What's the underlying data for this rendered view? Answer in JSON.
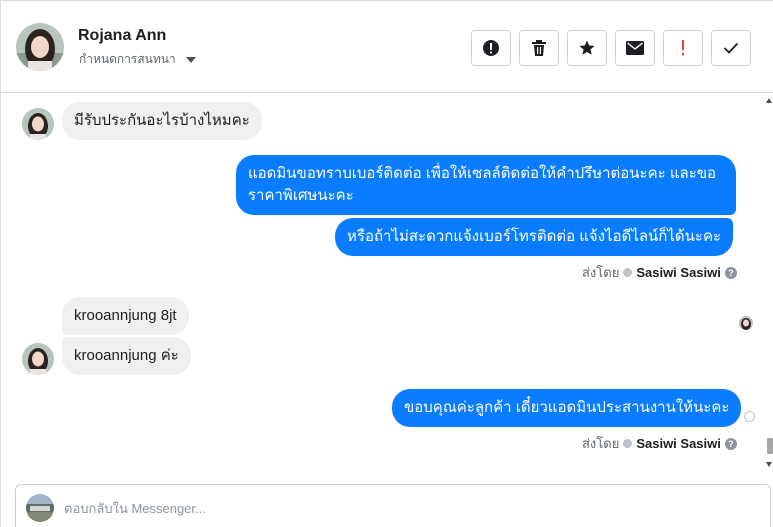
{
  "header": {
    "contact_name": "Rojana Ann",
    "assign_label": "กำหนดการสนทนา",
    "actions": [
      {
        "name": "mark-spam",
        "icon": "exclamation-circle-icon"
      },
      {
        "name": "delete",
        "icon": "trash-icon"
      },
      {
        "name": "star",
        "icon": "star-icon"
      },
      {
        "name": "mark-unread",
        "icon": "envelope-icon"
      },
      {
        "name": "follow-up",
        "icon": "exclamation-icon",
        "color": "#fa3e3e"
      },
      {
        "name": "mark-done",
        "icon": "check-icon"
      }
    ]
  },
  "messages": [
    {
      "direction": "in",
      "text": "มีรับประกันอะไรบ้างไหมคะ"
    },
    {
      "direction": "out",
      "lines": [
        "แอดมินขอทราบเบอร์ติดต่อ เพื่อให้เซลล์ติดต่อให้คำปรึษาต่อนะคะ และขอ",
        "ราคาพิเศษนะคะ"
      ]
    },
    {
      "direction": "out",
      "text": "หรือถ้าไม่สะดวกแจ้งเบอร์โทรติดต่อ แจ้งไอดีไลน์ก็ได้นะคะ"
    },
    {
      "direction": "in",
      "text": "krooannjung 8jt"
    },
    {
      "direction": "in",
      "text": "krooannjung ค่ะ"
    },
    {
      "direction": "out",
      "text": "ขอบคุณค่ะลูกค้า เดี๋ยวแอดมินประสานงานให้นะคะ"
    }
  ],
  "sent_by": {
    "prefix": "ส่งโดย",
    "sender": "Sasiwi Sasiwi",
    "help": "?"
  },
  "reply": {
    "placeholder": "ตอบกลับใน Messenger..."
  },
  "colors": {
    "outgoing_bubble": "#0a7cff",
    "incoming_bubble": "#f0f0f0",
    "follow_up": "#fa3e3e"
  }
}
